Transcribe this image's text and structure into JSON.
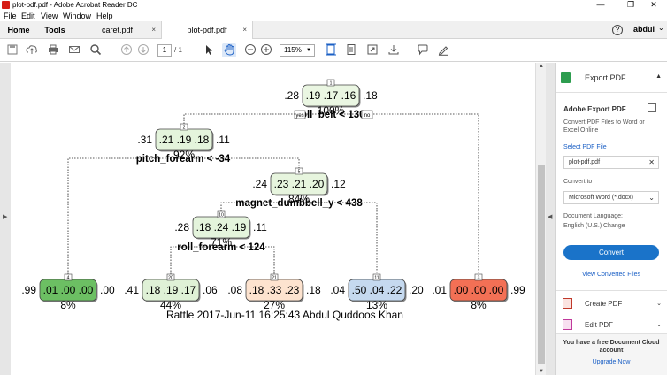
{
  "titlebar": {
    "title": "plot-pdf.pdf - Adobe Acrobat Reader DC",
    "minimize_glyph": "—",
    "maximize_glyph": "❐",
    "close_glyph": "✕"
  },
  "menu": [
    "File",
    "Edit",
    "View",
    "Window",
    "Help"
  ],
  "tabs": {
    "home": "Home",
    "tools": "Tools",
    "docs": [
      {
        "label": "caret.pdf",
        "active": false
      },
      {
        "label": "plot-pdf.pdf",
        "active": true
      }
    ],
    "close_glyph": "×"
  },
  "header_right": {
    "help_glyph": "?",
    "user": "abdul",
    "caret_glyph": "⌄"
  },
  "toolbar": {
    "page_current": "1",
    "page_total": "/ 1",
    "zoom": "115%",
    "icons": [
      "save-icon",
      "upload-icon",
      "print-icon",
      "mail-icon",
      "search-icon",
      "prev-page-icon",
      "next-page-icon",
      "select-cursor-icon",
      "hand-icon",
      "zoom-out-icon",
      "zoom-in-icon",
      "fit-page-icon",
      "scroll-mode-icon",
      "fullscreen-icon",
      "download-icon",
      "comment-icon",
      "sign-icon"
    ]
  },
  "tree": {
    "nodes": [
      {
        "id": "n1",
        "left": ".28",
        "probs": ".19  .17  .16",
        "right": ".18",
        "pct": "100%",
        "color": "#eaf6e2",
        "num": "1"
      },
      {
        "id": "n2",
        "left": ".31",
        "probs": ".21  .19  .18",
        "right": ".11",
        "pct": "92%",
        "color": "#e4f4dc",
        "num": "2"
      },
      {
        "id": "n5",
        "left": ".24",
        "probs": ".23  .21  .20",
        "right": ".12",
        "pct": "84%",
        "color": "#e7f5de",
        "num": "5"
      },
      {
        "id": "n10",
        "left": ".28",
        "probs": ".18  .24  .19",
        "right": ".11",
        "pct": "71%",
        "color": "#e4f4dc",
        "num": "10"
      },
      {
        "id": "leaf4",
        "left": ".99",
        "probs": ".01  .00  .00",
        "right": ".00",
        "pct": "8%",
        "color": "#6cbf63",
        "num": "4"
      },
      {
        "id": "leaf20",
        "left": ".41",
        "probs": ".18  .19  .17",
        "right": ".06",
        "pct": "44%",
        "color": "#dff1d6",
        "num": "20"
      },
      {
        "id": "leaf21",
        "left": ".08",
        "probs": ".18  .33  .23",
        "right": ".18",
        "pct": "27%",
        "color": "#fde3cf",
        "num": "21"
      },
      {
        "id": "leaf11",
        "left": ".04",
        "probs": ".50  .04  .22",
        "right": ".20",
        "pct": "13%",
        "color": "#c5d9ef",
        "num": "11"
      },
      {
        "id": "leaf3",
        "left": ".01",
        "probs": ".00  .00  .00",
        "right": ".99",
        "pct": "8%",
        "color": "#f37055",
        "num": "3"
      }
    ],
    "splits": [
      {
        "label": "roll_belt < 130",
        "yes": "yes",
        "no": "no"
      },
      {
        "label": "pitch_forearm < -34"
      },
      {
        "label": "magnet_dumbbell_y < 438"
      },
      {
        "label": "roll_forearm < 124"
      }
    ],
    "caption": "Rattle 2017-Jun-11 16:25:43 Abdul Quddoos Khan"
  },
  "right_pane": {
    "export_header": "Export PDF",
    "title": "Adobe Export PDF",
    "description": "Convert PDF Files to Word or Excel Online",
    "select_file": "Select PDF File",
    "file_name": "plot-pdf.pdf",
    "convert_to_label": "Convert to",
    "convert_to_value": "Microsoft Word (*.docx)",
    "doc_language_label": "Document Language:",
    "doc_language_value": "English (U.S.)",
    "change_link": "Change",
    "convert_button": "Convert",
    "view_converted": "View Converted Files",
    "actions": [
      "Create PDF",
      "Edit PDF"
    ],
    "promo_line1": "You have a free Document Cloud account",
    "upgrade": "Upgrade Now"
  }
}
